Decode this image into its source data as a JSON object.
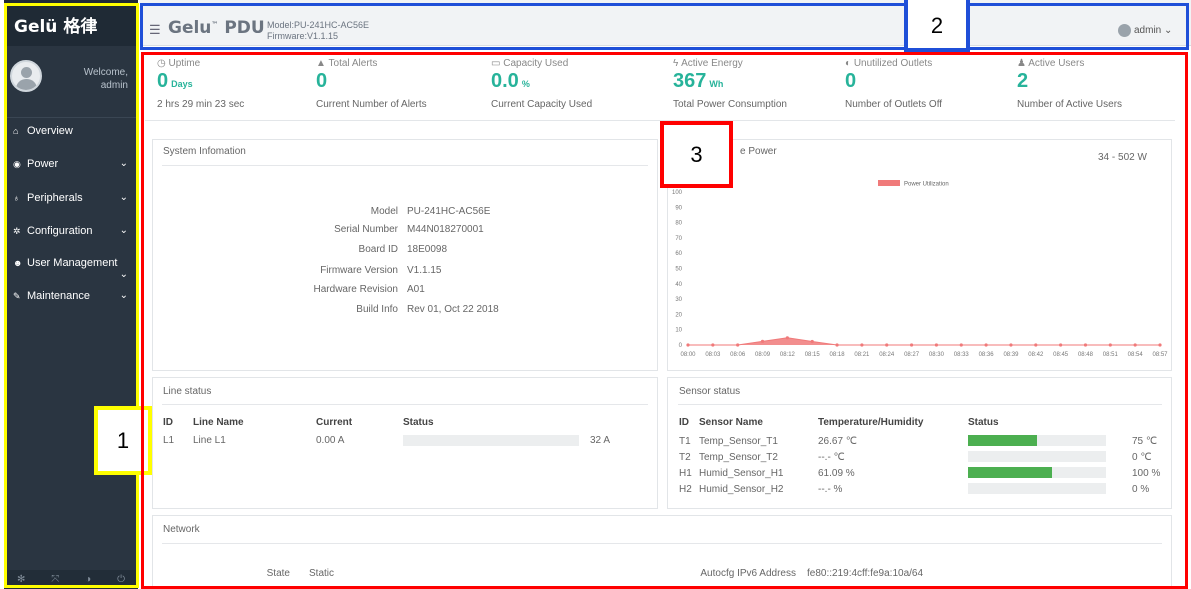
{
  "sidebar": {
    "logo": "Gelü 格律",
    "welcome_line1": "Welcome,",
    "welcome_user": "admin",
    "items": [
      {
        "label": "Overview",
        "icon": "dashboard-icon",
        "has_chevron": false
      },
      {
        "label": "Power",
        "icon": "power-icon",
        "has_chevron": true
      },
      {
        "label": "Peripherals",
        "icon": "plug-icon",
        "has_chevron": true
      },
      {
        "label": "Configuration",
        "icon": "cogs-icon",
        "has_chevron": true
      },
      {
        "label": "User Management",
        "icon": "users-icon",
        "has_chevron": true
      },
      {
        "label": "Maintenance",
        "icon": "wrench-icon",
        "has_chevron": true
      }
    ],
    "footer_icons": [
      "gear-icon",
      "fullscreen-icon",
      "eye-slash-icon",
      "power-off-icon"
    ]
  },
  "header": {
    "brand": "Gelu",
    "brand_tm": "™",
    "brand_suffix": "PDU",
    "model": "Model:PU-241HC-AC56E",
    "firmware": "Firmware:V1.1.15",
    "user": "admin",
    "user_chevron": "⌄"
  },
  "stats": [
    {
      "label": "Uptime",
      "icon": "clock-icon",
      "value": "0",
      "unit": "Days",
      "sub": "2 hrs 29 min 23 sec"
    },
    {
      "label": "Total Alerts",
      "icon": "warning-icon",
      "value": "0",
      "unit": "",
      "sub": "Current Number of Alerts"
    },
    {
      "label": "Capacity Used",
      "icon": "battery-icon",
      "value": "0.0",
      "unit": "%",
      "sub": "Current Capacity Used"
    },
    {
      "label": "Active Energy",
      "icon": "bolt-icon",
      "value": "367",
      "unit": "Wh",
      "sub": "Total Power Consumption"
    },
    {
      "label": "Unutilized Outlets",
      "icon": "toggle-icon",
      "value": "0",
      "unit": "",
      "sub": "Number of Outlets Off"
    },
    {
      "label": "Active Users",
      "icon": "user-icon",
      "value": "2",
      "unit": "",
      "sub": "Number of Active Users"
    }
  ],
  "system_info": {
    "title": "System Infomation",
    "rows": [
      {
        "key": "Model",
        "value": "PU-241HC-AC56E"
      },
      {
        "key": "Serial Number",
        "value": "M44N018270001"
      },
      {
        "key": "Board ID",
        "value": "18E0098"
      },
      {
        "key": "Firmware Version",
        "value": "V1.1.15"
      },
      {
        "key": "Hardware Revision",
        "value": "A01"
      },
      {
        "key": "Build Info",
        "value": "Rev 01, Oct 22 2018"
      }
    ]
  },
  "power_panel": {
    "title": "e Power",
    "range": "34 - 502 W"
  },
  "chart_data": {
    "type": "area",
    "title": "",
    "xlabel": "",
    "ylabel": "",
    "ylim": [
      0,
      100
    ],
    "yticks": [
      0,
      10,
      20,
      30,
      40,
      50,
      60,
      70,
      80,
      90,
      100
    ],
    "legend": "top-center",
    "series": [
      {
        "name": "Power Utilization",
        "color": "#f07a7a",
        "values": [
          0,
          0,
          0,
          2.4,
          4.7,
          2.3,
          0,
          0,
          0,
          0,
          0,
          0,
          0,
          0,
          0,
          0,
          0,
          0,
          0,
          0
        ]
      }
    ],
    "categories": [
      "08:00",
      "08:03",
      "08:06",
      "08:09",
      "08:12",
      "08:15",
      "08:18",
      "08:21",
      "08:24",
      "08:27",
      "08:30",
      "08:33",
      "08:36",
      "08:39",
      "08:42",
      "08:45",
      "08:48",
      "08:51",
      "08:54",
      "08:57"
    ]
  },
  "line_status": {
    "title": "Line status",
    "headers": [
      "ID",
      "Line Name",
      "Current",
      "Status"
    ],
    "rows": [
      {
        "id": "L1",
        "name": "Line L1",
        "current": "0.00 A",
        "max": "32 A",
        "fraction": 0.0
      }
    ]
  },
  "sensor_status": {
    "title": "Sensor status",
    "headers": [
      "ID",
      "Sensor Name",
      "Temperature/Humidity",
      "Status"
    ],
    "rows": [
      {
        "id": "T1",
        "name": "Temp_Sensor_T1",
        "reading": "26.67 ℃",
        "max": "75 ℃",
        "fraction": 0.5
      },
      {
        "id": "T2",
        "name": "Temp_Sensor_T2",
        "reading": "--.- ℃",
        "max": "0 ℃",
        "fraction": 0.0
      },
      {
        "id": "H1",
        "name": "Humid_Sensor_H1",
        "reading": "61.09 %",
        "max": "100 %",
        "fraction": 0.61
      },
      {
        "id": "H2",
        "name": "Humid_Sensor_H2",
        "reading": "--.- %",
        "max": "0 %",
        "fraction": 0.0
      }
    ]
  },
  "network": {
    "title": "Network",
    "state_label": "State",
    "state_value": "Static",
    "ipv6_label": "Autocfg IPv6 Address",
    "ipv6_value": "fe80::219:4cff:fe9a:10a/64"
  },
  "annotations": {
    "box1": "1",
    "box2": "2",
    "box3": "3",
    "color_sidebar": "#ffff00",
    "color_header": "#1f4fd8",
    "color_main": "#ff0000"
  }
}
